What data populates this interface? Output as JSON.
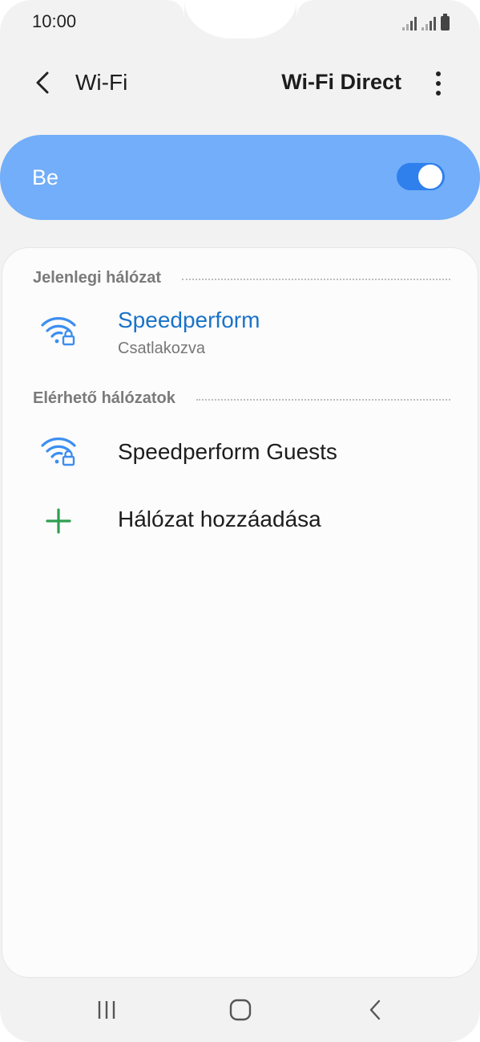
{
  "status": {
    "time": "10:00"
  },
  "app_bar": {
    "title": "Wi-Fi",
    "action": "Wi-Fi Direct"
  },
  "toggle": {
    "label": "Be",
    "state": "on"
  },
  "sections": {
    "current": {
      "title": "Jelenlegi hálózat",
      "network": {
        "name": "Speedperform",
        "status": "Csatlakozva"
      }
    },
    "available": {
      "title": "Elérhető hálózatok",
      "networks": [
        {
          "name": "Speedperform Guests"
        }
      ],
      "add_label": "Hálózat hozzáadása"
    }
  },
  "colors": {
    "toggle_card": "#72aef9",
    "accent": "#1a73c8",
    "add_icon": "#2e9e4f",
    "wifi_icon": "#3d8ef0"
  },
  "icons": {
    "back": "chevron-left-icon",
    "more": "more-vertical-icon",
    "wifi_locked": "wifi-lock-icon",
    "add": "plus-icon",
    "nav_recent": "recent-apps-icon",
    "nav_home": "home-icon",
    "nav_back": "back-icon"
  }
}
